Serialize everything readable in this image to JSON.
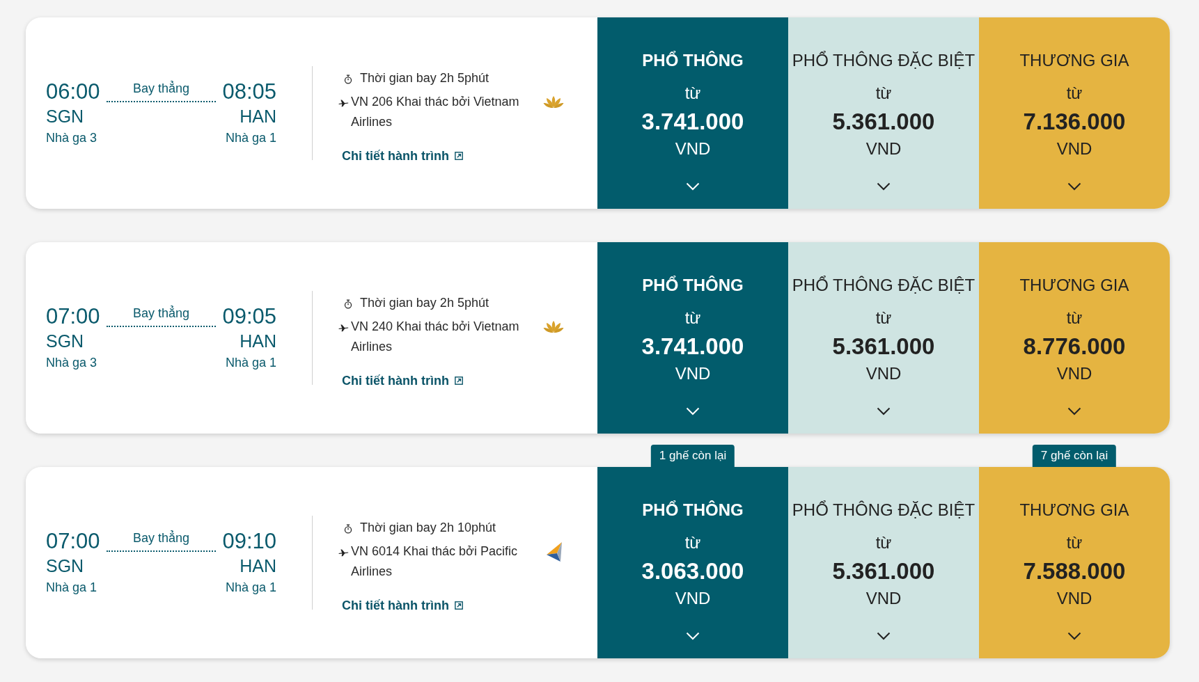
{
  "flights": [
    {
      "departure": {
        "time": "06:00",
        "airport": "SGN",
        "terminal": "Nhà ga 3"
      },
      "stop_label": "Bay thẳng",
      "arrival": {
        "time": "08:05",
        "airport": "HAN",
        "terminal": "Nhà ga 1"
      },
      "duration": "Thời gian bay 2h 5phút",
      "operator": "VN 206 Khai thác bởi Vietnam Airlines",
      "logo": {
        "kind": "lotus"
      },
      "details_link": "Chi tiết hành trình",
      "fares": [
        {
          "kind": "economy",
          "title": "PHỔ THÔNG",
          "from_label": "từ",
          "price": "3.741.000",
          "currency": "VND",
          "expanded": false
        },
        {
          "kind": "premium",
          "title": "PHỔ THÔNG ĐẶC BIỆT",
          "from_label": "từ",
          "price": "5.361.000",
          "currency": "VND",
          "expanded": false
        },
        {
          "kind": "business",
          "title": "THƯƠNG GIA",
          "from_label": "từ",
          "price": "7.136.000",
          "currency": "VND",
          "expanded": false
        }
      ]
    },
    {
      "departure": {
        "time": "07:00",
        "airport": "SGN",
        "terminal": "Nhà ga 3"
      },
      "stop_label": "Bay thẳng",
      "arrival": {
        "time": "09:05",
        "airport": "HAN",
        "terminal": "Nhà ga 1"
      },
      "duration": "Thời gian bay 2h 5phút",
      "operator": "VN 240 Khai thác bởi Vietnam Airlines",
      "logo": {
        "kind": "lotus"
      },
      "details_link": "Chi tiết hành trình",
      "fares": [
        {
          "kind": "economy",
          "title": "PHỔ THÔNG",
          "from_label": "từ",
          "price": "3.741.000",
          "currency": "VND",
          "expanded": false
        },
        {
          "kind": "premium",
          "title": "PHỔ THÔNG ĐẶC BIỆT",
          "from_label": "từ",
          "price": "5.361.000",
          "currency": "VND",
          "expanded": false
        },
        {
          "kind": "business",
          "title": "THƯƠNG GIA",
          "from_label": "từ",
          "price": "8.776.000",
          "currency": "VND",
          "expanded": false
        }
      ]
    },
    {
      "departure": {
        "time": "07:00",
        "airport": "SGN",
        "terminal": "Nhà ga 1"
      },
      "stop_label": "Bay thẳng",
      "arrival": {
        "time": "09:10",
        "airport": "HAN",
        "terminal": "Nhà ga 1"
      },
      "duration": "Thời gian bay 2h 10phút",
      "operator": "VN 6014 Khai thác bởi Pacific Airlines",
      "logo": {
        "kind": "triangle"
      },
      "details_link": "Chi tiết hành trình",
      "fares": [
        {
          "kind": "economy",
          "title": "PHỔ THÔNG",
          "from_label": "từ",
          "price": "3.063.000",
          "currency": "VND",
          "expanded": false,
          "seats_left": "1 ghế còn lại"
        },
        {
          "kind": "premium",
          "title": "PHỔ THÔNG ĐẶC BIỆT",
          "from_label": "từ",
          "price": "5.361.000",
          "currency": "VND",
          "expanded": false
        },
        {
          "kind": "business",
          "title": "THƯƠNG GIA",
          "from_label": "từ",
          "price": "7.588.000",
          "currency": "VND",
          "expanded": false,
          "seats_left": "7 ghế còn lại"
        }
      ]
    }
  ]
}
